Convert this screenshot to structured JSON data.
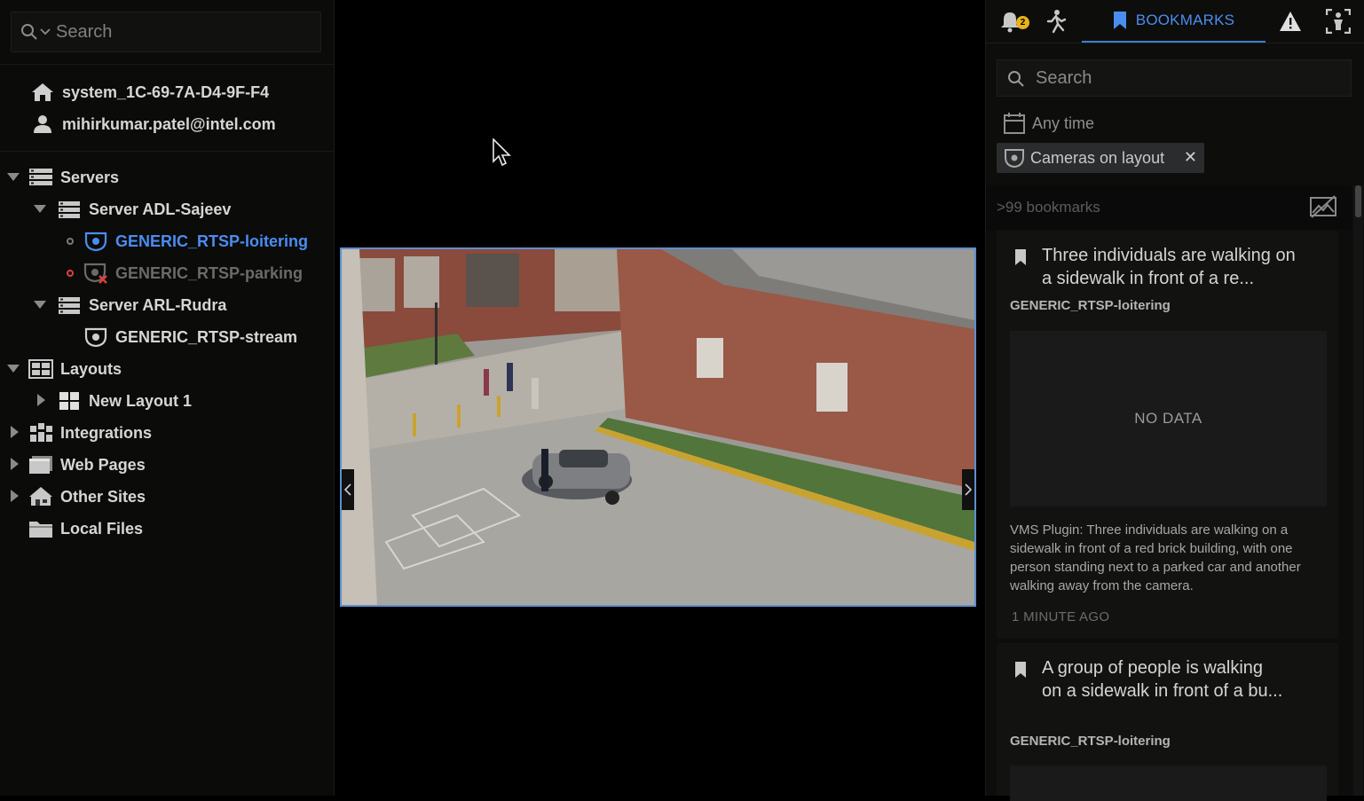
{
  "left_panel": {
    "search_placeholder": "Search",
    "system_name": "system_1C-69-7A-D4-9F-F4",
    "user_email": "mihirkumar.patel@intel.com",
    "tree": {
      "servers_label": "Servers",
      "server1_label": "Server ADL-Sajeev",
      "camera1_label": "GENERIC_RTSP-loitering",
      "camera2_label": "GENERIC_RTSP-parking",
      "server2_label": "Server ARL-Rudra",
      "camera3_label": "GENERIC_RTSP-stream",
      "layouts_label": "Layouts",
      "layout1_label": "New Layout 1",
      "integrations_label": "Integrations",
      "webpages_label": "Web Pages",
      "othersites_label": "Other Sites",
      "localfiles_label": "Local Files"
    }
  },
  "right_panel": {
    "notification_count": "2",
    "bookmarks_tab_label": "BOOKMARKS",
    "search_placeholder": "Search",
    "time_filter": "Any time",
    "camera_filter_chip": "Cameras on layout",
    "chip_close": "✕",
    "results_count": ">99 bookmarks",
    "bookmarks": [
      {
        "title": "Three individuals are walking on a sidewalk in front of a re...",
        "camera": "GENERIC_RTSP-loitering",
        "thumbnail_text": "NO DATA",
        "description": "VMS Plugin: Three individuals are walking on a sidewalk in front of a red brick building, with one person standing next to a parked car and another walking away from the camera.",
        "time": "1 MINUTE AGO"
      },
      {
        "title": "A group of people is walking on a sidewalk in front of a bu...",
        "camera": "GENERIC_RTSP-loitering"
      }
    ]
  },
  "colors": {
    "accent_blue": "#4a8df0",
    "badge_yellow": "#e8b419",
    "camera_error_red": "#e0403a",
    "tile_border": "#5d8fce"
  }
}
